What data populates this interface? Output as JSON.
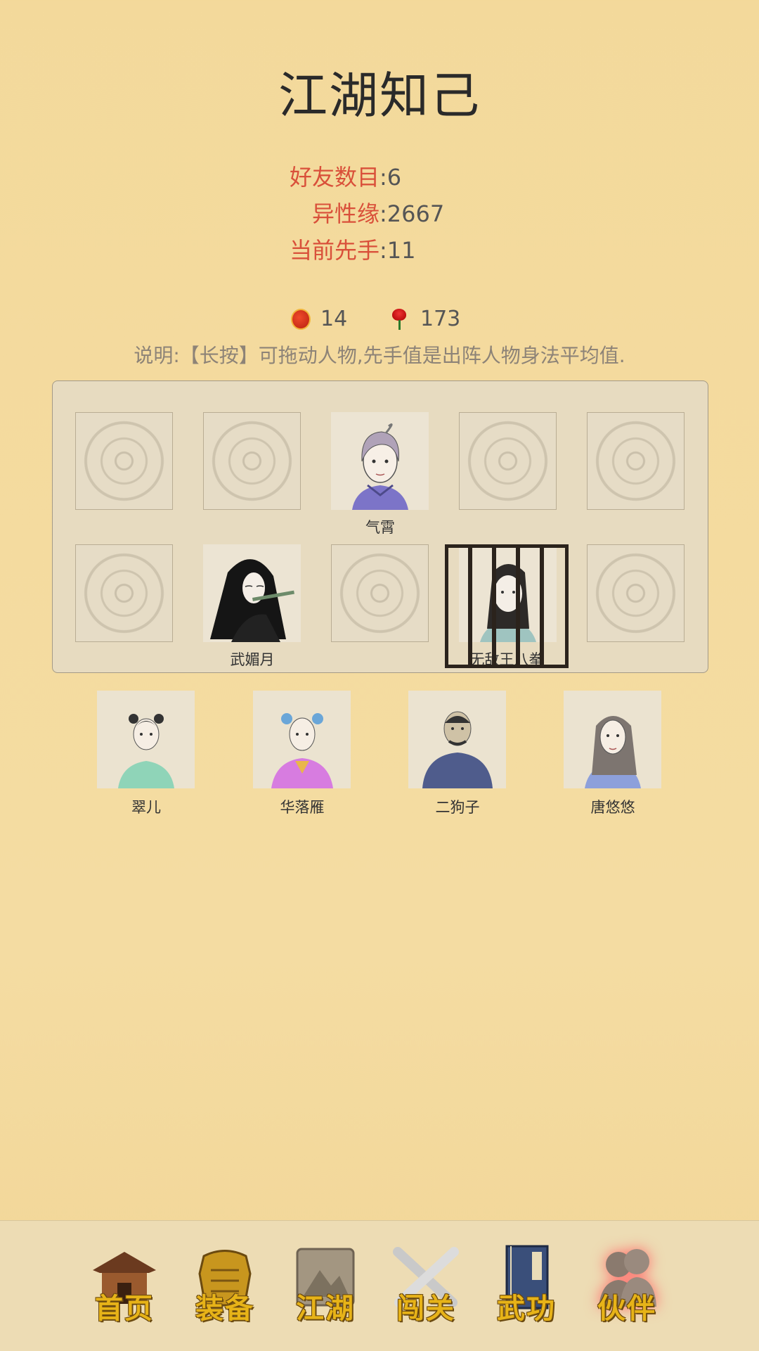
{
  "header": {
    "title": "江湖知己"
  },
  "stats": [
    {
      "label": "好友数目",
      "value": ":6"
    },
    {
      "label": "异性缘",
      "value": ":2667"
    },
    {
      "label": "当前先手",
      "value": ":11"
    }
  ],
  "currency": [
    {
      "icon": "gourd-icon",
      "value": "14"
    },
    {
      "icon": "rose-icon",
      "value": "173"
    }
  ],
  "note": "说明:【长按】可拖动人物,先手值是出阵人物身法平均值.",
  "formation": {
    "slots": [
      {
        "name": ""
      },
      {
        "name": ""
      },
      {
        "name": "气霄"
      },
      {
        "name": ""
      },
      {
        "name": ""
      },
      {
        "name": ""
      },
      {
        "name": "武媚月"
      },
      {
        "name": ""
      },
      {
        "name": "无敌王八拳"
      },
      {
        "name": ""
      }
    ]
  },
  "bench": [
    {
      "name": "翠儿"
    },
    {
      "name": "华落雁"
    },
    {
      "name": "二狗子"
    },
    {
      "name": "唐悠悠"
    }
  ],
  "nav": [
    {
      "label": "首页",
      "icon": "home-icon"
    },
    {
      "label": "装备",
      "icon": "armor-icon"
    },
    {
      "label": "江湖",
      "icon": "scroll-map-icon"
    },
    {
      "label": "闯关",
      "icon": "crossed-swords-icon"
    },
    {
      "label": "武功",
      "icon": "book-icon"
    },
    {
      "label": "伙伴",
      "icon": "partners-icon",
      "active": true
    }
  ]
}
